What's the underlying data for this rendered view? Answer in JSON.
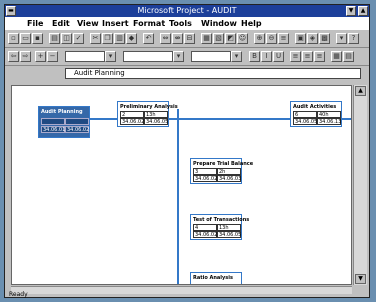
{
  "window": {
    "title": "Microsoft Project - AUDIT"
  },
  "menu": [
    {
      "label": "File"
    },
    {
      "label": "Edit"
    },
    {
      "label": "View"
    },
    {
      "label": "Insert"
    },
    {
      "label": "Format"
    },
    {
      "label": "Tools"
    },
    {
      "label": "Window"
    },
    {
      "label": "Help"
    }
  ],
  "entry_bar": {
    "value": "Audit Planning"
  },
  "nodes": [
    {
      "name": "Audit Planning",
      "cells": [
        "",
        "",
        "34.06.01",
        "34.06.02"
      ],
      "critical": true
    },
    {
      "name": "Preliminary Analysis",
      "cells": [
        "2",
        "13h",
        "34.06.02",
        "34.06.05"
      ],
      "critical": false
    },
    {
      "name": "Audit Activities",
      "cells": [
        "6",
        "40h",
        "34.06.05",
        "34.06.13"
      ],
      "critical": false
    },
    {
      "name": "Prepare Trial Balance",
      "cells": [
        "3",
        "2h",
        "34.06.02",
        "34.06.03"
      ],
      "critical": false
    },
    {
      "name": "Test of Transactions",
      "cells": [
        "4",
        "13h",
        "34.06.02",
        "34.06.05"
      ],
      "critical": false
    },
    {
      "name": "Ratio Analysis",
      "cells": [
        "",
        "",
        "",
        ""
      ],
      "critical": false
    }
  ],
  "status": {
    "text": "Ready"
  }
}
